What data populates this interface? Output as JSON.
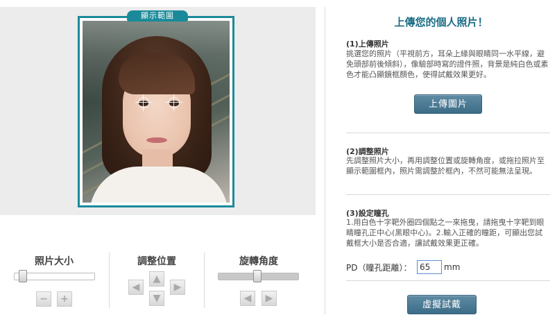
{
  "preview": {
    "tag": "顯示範圍"
  },
  "controls": {
    "size": {
      "title": "照片大小",
      "value_fraction": 0.1
    },
    "position": {
      "title": "調整位置"
    },
    "rotate": {
      "title": "旋轉角度",
      "value_fraction": 0.5
    }
  },
  "panel": {
    "title": "上傳您的個人照片！",
    "section1": {
      "title": "(1)上傳照片",
      "body": "挑選您的照片（平視前方，耳朵上緣與眼睛同一水平線，避免頭部前後傾斜），像驗部時寫的證件照，背景是純白色或素色才能凸顯鏡框顏色，使得試戴效果更好。",
      "button": "上傳圖片"
    },
    "section2": {
      "title": "(2)調整照片",
      "body": "先調整照片大小，再用調整位置或旋轉角度，或拖拉照片至顯示範圍框內，照片需調整於框內，不然可能無法呈現。"
    },
    "section3": {
      "title": "(3)設定瞳孔",
      "body": "1.用白色十字靶外圈四個點之一來拖曳，請拖曳十字靶到眼睛瞳孔正中心(黑眼中心)。2.輸入正確的瞳距，可顯出您試戴框大小是否合適，讓試戴效果更正確。",
      "pd_label": "PD（瞳孔距離）：",
      "pd_value": "65",
      "pd_unit": "mm"
    },
    "try_on_button": "虛擬試戴"
  },
  "icons": {
    "minus": "minus-icon",
    "plus": "plus-icon",
    "up": "arrow-up-icon",
    "down": "arrow-down-icon",
    "left": "arrow-left-icon",
    "right": "arrow-right-icon",
    "rotate_left": "rotate-left-icon",
    "rotate_right": "rotate-right-icon"
  },
  "colors": {
    "accent": "#1a8a9a",
    "title": "#1a6c85",
    "button": "#3c6c87"
  }
}
